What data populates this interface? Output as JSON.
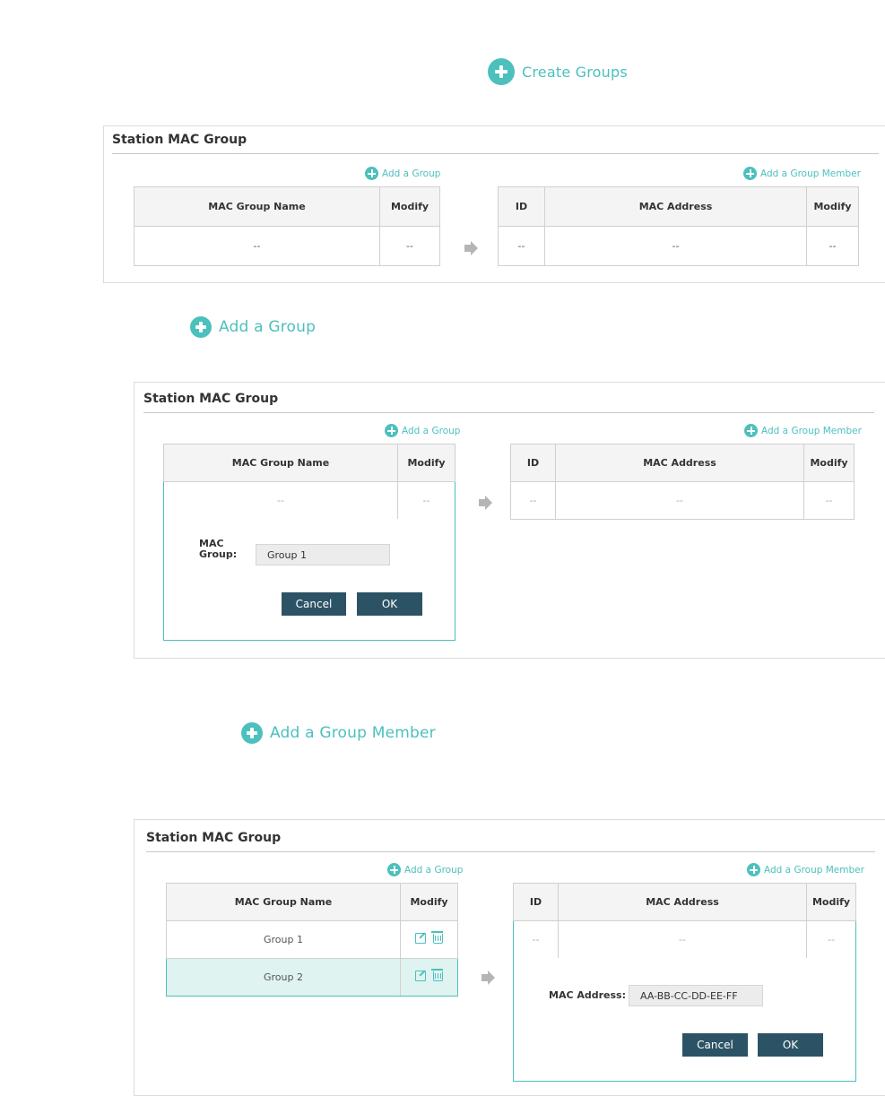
{
  "callouts": {
    "create_groups": "Create Groups",
    "add_group": "Add a Group",
    "add_member": "Add a Group Member"
  },
  "panel_title": "Station MAC Group",
  "links": {
    "add_group": "Add a Group",
    "add_member": "Add a Group Member"
  },
  "group_table": {
    "headers": [
      "MAC Group Name",
      "Modify"
    ],
    "empty_row": [
      "--",
      "--"
    ]
  },
  "member_table": {
    "headers": [
      "ID",
      "MAC Address",
      "Modify"
    ],
    "empty_row": [
      "--",
      "--",
      "--"
    ]
  },
  "group_form": {
    "label_line1": "MAC",
    "label_line2": "Group:",
    "value": "Group 1",
    "cancel": "Cancel",
    "ok": "OK"
  },
  "groups": [
    {
      "name": "Group 1"
    },
    {
      "name": "Group 2"
    }
  ],
  "member_form": {
    "label": "MAC Address:",
    "value": "AA-BB-CC-DD-EE-FF",
    "cancel": "Cancel",
    "ok": "OK"
  },
  "colors": {
    "accent": "#4cc0bd",
    "button": "#2c5365",
    "selected_row": "#dff3f1"
  }
}
